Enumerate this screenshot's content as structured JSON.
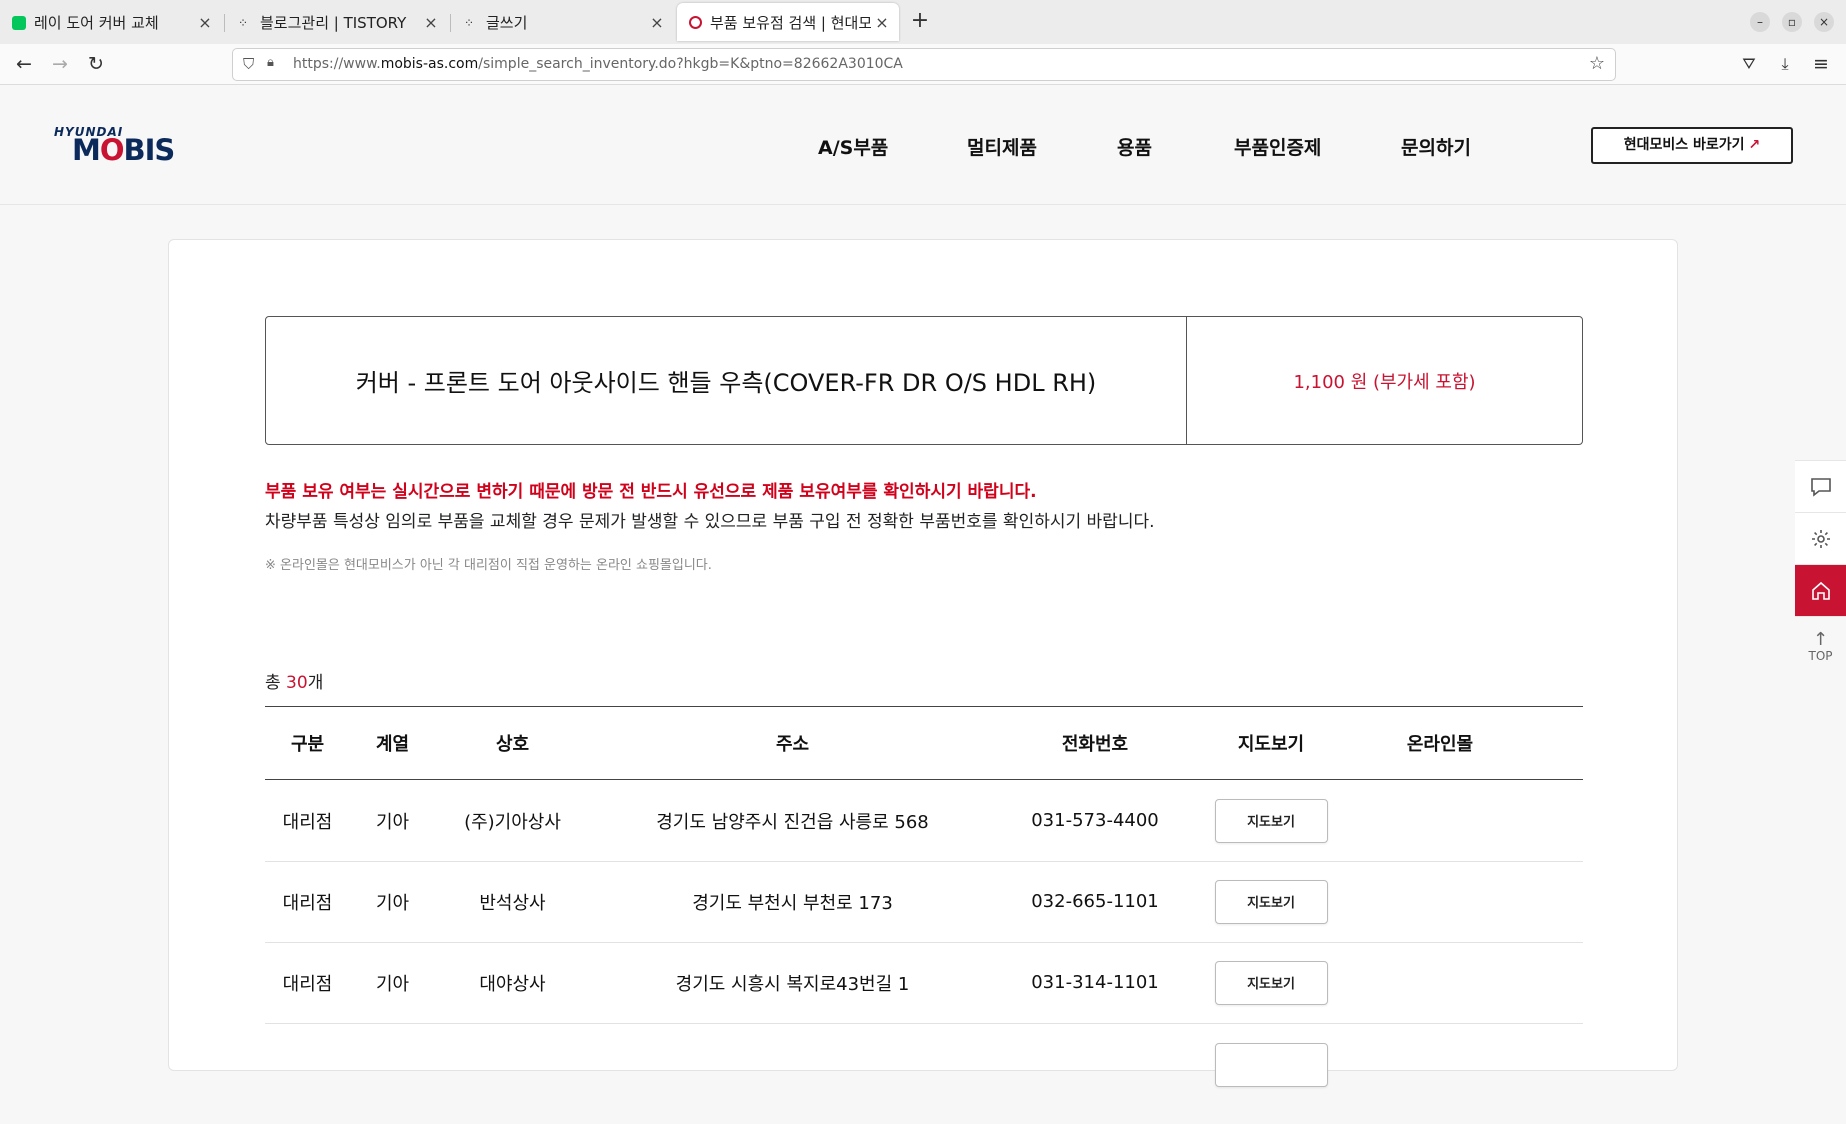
{
  "browser": {
    "tabs": [
      {
        "title": "레이 도어 커버 교체",
        "favicon_color": "#03c75a"
      },
      {
        "title": "블로그관리 | TISTORY",
        "favicon_color": "#333333"
      },
      {
        "title": "글쓰기",
        "favicon_color": "#333333"
      },
      {
        "title": "부품 보유점 검색 | 현대모비",
        "favicon_color": "#c81432"
      }
    ],
    "url_prefix": "https://www.",
    "url_domain": "mobis-as.com",
    "url_path": "/simple_search_inventory.do?hkgb=K&ptno=82662A3010CA"
  },
  "site": {
    "logo_top": "HYUNDAI",
    "logo_main_a": "M",
    "logo_main_o": "O",
    "logo_main_b": "BIS",
    "nav": [
      "A/S부품",
      "멀티제품",
      "용품",
      "부품인증제",
      "문의하기"
    ],
    "shortcut_label": "현대모비스 바로가기",
    "shortcut_arrow": "↗"
  },
  "product": {
    "name": "커버 - 프론트 도어 아웃사이드 핸들 우측(COVER-FR DR O/S HDL RH)",
    "price": "1,100 원 (부가세 포함)"
  },
  "notices": {
    "warning": "부품 보유 여부는 실시간으로 변하기 때문에 방문 전 반드시 유선으로 제품 보유여부를 확인하시기 바랍니다.",
    "caution": "차량부품 특성상 임의로 부품을 교체할 경우 문제가 발생할 수 있으므로 부품 구입 전 정확한 부품번호를 확인하시기 바랍니다.",
    "note": "※ 온라인몰은 현대모비스가 아닌 각 대리점이 직접 운영하는 온라인 쇼핑몰입니다."
  },
  "results": {
    "total_prefix": "총 ",
    "total_count": "30",
    "total_suffix": "개",
    "headers": [
      "구분",
      "계열",
      "상호",
      "주소",
      "전화번호",
      "지도보기",
      "온라인몰"
    ],
    "map_button_label": "지도보기",
    "rows": [
      {
        "type": "대리점",
        "group": "기아",
        "name": "(주)기아상사",
        "address": "경기도 남양주시 진건읍 사릉로 568",
        "phone": "031-573-4400",
        "online": ""
      },
      {
        "type": "대리점",
        "group": "기아",
        "name": "반석상사",
        "address": "경기도 부천시 부천로 173",
        "phone": "032-665-1101",
        "online": ""
      },
      {
        "type": "대리점",
        "group": "기아",
        "name": "대야상사",
        "address": "경기도 시흥시 복지로43번길 1",
        "phone": "031-314-1101",
        "online": ""
      }
    ]
  },
  "quickbar": {
    "top_label": "TOP",
    "icons": [
      "chat-icon",
      "gear-icon",
      "home-icon",
      "arrow-up-icon"
    ]
  },
  "colors": {
    "accent": "#c81432",
    "warning_text": "#d0021b",
    "logo_navy": "#0b2a5b"
  }
}
